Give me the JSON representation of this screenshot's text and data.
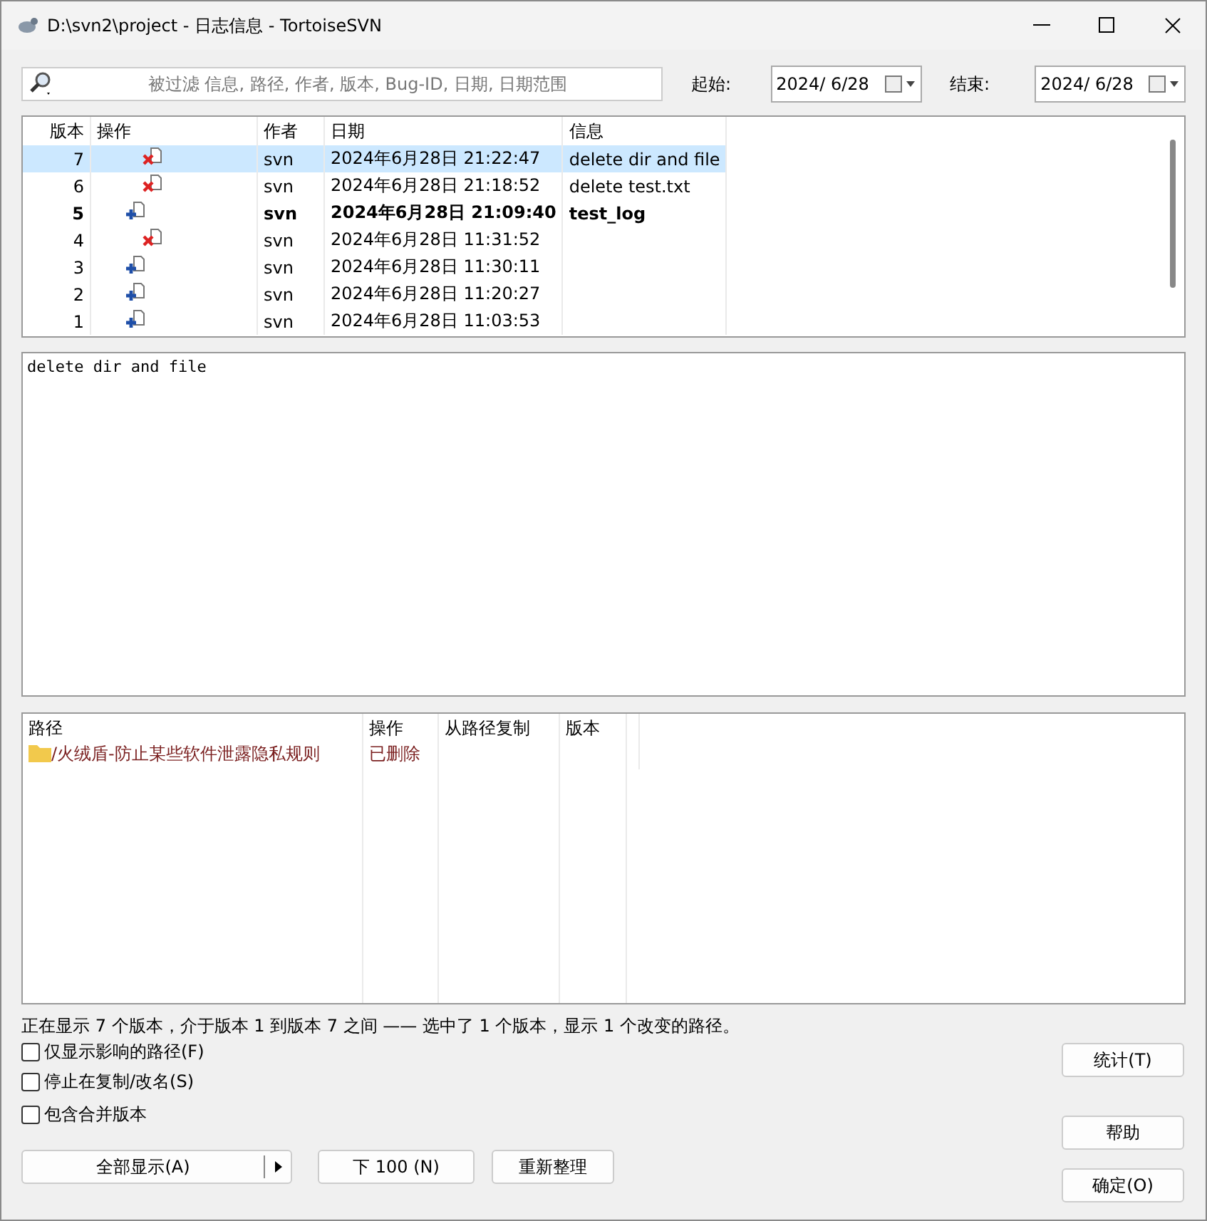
{
  "window": {
    "title": "D:\\svn2\\project - 日志信息 - TortoiseSVN"
  },
  "filter": {
    "placeholder": "被过滤 信息, 路径, 作者, 版本, Bug-ID, 日期, 日期范围",
    "from_label": "起始:",
    "from_value": "2024/  6/28",
    "to_label": "结束:",
    "to_value": "2024/  6/28"
  },
  "log": {
    "columns": [
      "版本",
      "操作",
      "作者",
      "日期",
      "信息"
    ],
    "rows": [
      {
        "revision": "7",
        "kind": "delete",
        "author": "svn",
        "date": "2024年6月28日 21:22:47",
        "message": "delete dir and file",
        "selected": true,
        "bold": false
      },
      {
        "revision": "6",
        "kind": "delete",
        "author": "svn",
        "date": "2024年6月28日 21:18:52",
        "message": "delete test.txt",
        "selected": false,
        "bold": false
      },
      {
        "revision": "5",
        "kind": "add",
        "author": "svn",
        "date": "2024年6月28日 21:09:40",
        "message": "test_log",
        "selected": false,
        "bold": true
      },
      {
        "revision": "4",
        "kind": "delete",
        "author": "svn",
        "date": "2024年6月28日 11:31:52",
        "selected": false,
        "bold": false
      },
      {
        "revision": "3",
        "kind": "add",
        "author": "svn",
        "date": "2024年6月28日 11:30:11",
        "selected": false,
        "bold": false
      },
      {
        "revision": "2",
        "kind": "add",
        "author": "svn",
        "date": "2024年6月28日 11:20:27",
        "selected": false,
        "bold": false
      },
      {
        "revision": "1",
        "kind": "add",
        "author": "svn",
        "date": "2024年6月28日 11:03:53",
        "selected": false,
        "bold": false
      }
    ]
  },
  "message_text": "delete dir and file",
  "paths": {
    "columns": [
      "路径",
      "操作",
      "从路径复制",
      "版本"
    ],
    "rows": [
      {
        "path": "/火绒盾-防止某些软件泄露隐私规则",
        "action": "已删除"
      }
    ]
  },
  "status": "正在显示 7 个版本，介于版本 1 到版本 7 之间 —— 选中了 1 个版本，显示 1 个改变的路径。",
  "options": [
    {
      "label": "仅显示影响的路径(F)",
      "checked": false
    },
    {
      "label": "停止在复制/改名(S)",
      "checked": false
    },
    {
      "label": "包含合并版本",
      "checked": false
    }
  ],
  "buttons": {
    "stats": "统计(T)",
    "help": "帮助",
    "show_all": "全部显示(A)",
    "next": "下 100 (N)",
    "refresh": "重新整理",
    "ok": "确定(O)"
  }
}
